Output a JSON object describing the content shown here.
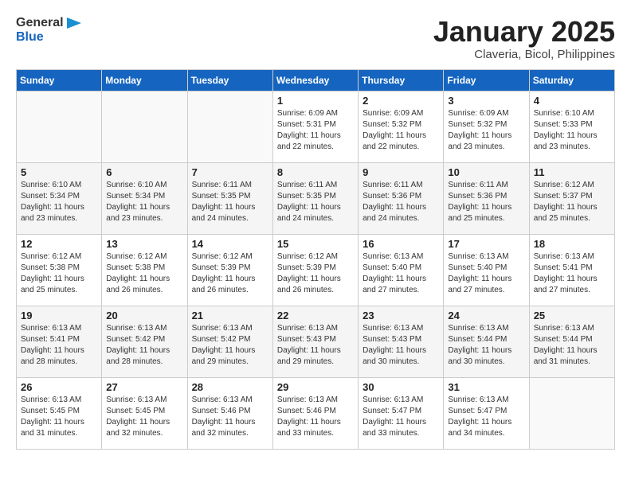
{
  "logo": {
    "line1": "General",
    "line2": "Blue"
  },
  "title": "January 2025",
  "subtitle": "Claveria, Bicol, Philippines",
  "headers": [
    "Sunday",
    "Monday",
    "Tuesday",
    "Wednesday",
    "Thursday",
    "Friday",
    "Saturday"
  ],
  "weeks": [
    [
      {
        "day": "",
        "info": ""
      },
      {
        "day": "",
        "info": ""
      },
      {
        "day": "",
        "info": ""
      },
      {
        "day": "1",
        "info": "Sunrise: 6:09 AM\nSunset: 5:31 PM\nDaylight: 11 hours and 22 minutes."
      },
      {
        "day": "2",
        "info": "Sunrise: 6:09 AM\nSunset: 5:32 PM\nDaylight: 11 hours and 22 minutes."
      },
      {
        "day": "3",
        "info": "Sunrise: 6:09 AM\nSunset: 5:32 PM\nDaylight: 11 hours and 23 minutes."
      },
      {
        "day": "4",
        "info": "Sunrise: 6:10 AM\nSunset: 5:33 PM\nDaylight: 11 hours and 23 minutes."
      }
    ],
    [
      {
        "day": "5",
        "info": "Sunrise: 6:10 AM\nSunset: 5:34 PM\nDaylight: 11 hours and 23 minutes."
      },
      {
        "day": "6",
        "info": "Sunrise: 6:10 AM\nSunset: 5:34 PM\nDaylight: 11 hours and 23 minutes."
      },
      {
        "day": "7",
        "info": "Sunrise: 6:11 AM\nSunset: 5:35 PM\nDaylight: 11 hours and 24 minutes."
      },
      {
        "day": "8",
        "info": "Sunrise: 6:11 AM\nSunset: 5:35 PM\nDaylight: 11 hours and 24 minutes."
      },
      {
        "day": "9",
        "info": "Sunrise: 6:11 AM\nSunset: 5:36 PM\nDaylight: 11 hours and 24 minutes."
      },
      {
        "day": "10",
        "info": "Sunrise: 6:11 AM\nSunset: 5:36 PM\nDaylight: 11 hours and 25 minutes."
      },
      {
        "day": "11",
        "info": "Sunrise: 6:12 AM\nSunset: 5:37 PM\nDaylight: 11 hours and 25 minutes."
      }
    ],
    [
      {
        "day": "12",
        "info": "Sunrise: 6:12 AM\nSunset: 5:38 PM\nDaylight: 11 hours and 25 minutes."
      },
      {
        "day": "13",
        "info": "Sunrise: 6:12 AM\nSunset: 5:38 PM\nDaylight: 11 hours and 26 minutes."
      },
      {
        "day": "14",
        "info": "Sunrise: 6:12 AM\nSunset: 5:39 PM\nDaylight: 11 hours and 26 minutes."
      },
      {
        "day": "15",
        "info": "Sunrise: 6:12 AM\nSunset: 5:39 PM\nDaylight: 11 hours and 26 minutes."
      },
      {
        "day": "16",
        "info": "Sunrise: 6:13 AM\nSunset: 5:40 PM\nDaylight: 11 hours and 27 minutes."
      },
      {
        "day": "17",
        "info": "Sunrise: 6:13 AM\nSunset: 5:40 PM\nDaylight: 11 hours and 27 minutes."
      },
      {
        "day": "18",
        "info": "Sunrise: 6:13 AM\nSunset: 5:41 PM\nDaylight: 11 hours and 27 minutes."
      }
    ],
    [
      {
        "day": "19",
        "info": "Sunrise: 6:13 AM\nSunset: 5:41 PM\nDaylight: 11 hours and 28 minutes."
      },
      {
        "day": "20",
        "info": "Sunrise: 6:13 AM\nSunset: 5:42 PM\nDaylight: 11 hours and 28 minutes."
      },
      {
        "day": "21",
        "info": "Sunrise: 6:13 AM\nSunset: 5:42 PM\nDaylight: 11 hours and 29 minutes."
      },
      {
        "day": "22",
        "info": "Sunrise: 6:13 AM\nSunset: 5:43 PM\nDaylight: 11 hours and 29 minutes."
      },
      {
        "day": "23",
        "info": "Sunrise: 6:13 AM\nSunset: 5:43 PM\nDaylight: 11 hours and 30 minutes."
      },
      {
        "day": "24",
        "info": "Sunrise: 6:13 AM\nSunset: 5:44 PM\nDaylight: 11 hours and 30 minutes."
      },
      {
        "day": "25",
        "info": "Sunrise: 6:13 AM\nSunset: 5:44 PM\nDaylight: 11 hours and 31 minutes."
      }
    ],
    [
      {
        "day": "26",
        "info": "Sunrise: 6:13 AM\nSunset: 5:45 PM\nDaylight: 11 hours and 31 minutes."
      },
      {
        "day": "27",
        "info": "Sunrise: 6:13 AM\nSunset: 5:45 PM\nDaylight: 11 hours and 32 minutes."
      },
      {
        "day": "28",
        "info": "Sunrise: 6:13 AM\nSunset: 5:46 PM\nDaylight: 11 hours and 32 minutes."
      },
      {
        "day": "29",
        "info": "Sunrise: 6:13 AM\nSunset: 5:46 PM\nDaylight: 11 hours and 33 minutes."
      },
      {
        "day": "30",
        "info": "Sunrise: 6:13 AM\nSunset: 5:47 PM\nDaylight: 11 hours and 33 minutes."
      },
      {
        "day": "31",
        "info": "Sunrise: 6:13 AM\nSunset: 5:47 PM\nDaylight: 11 hours and 34 minutes."
      },
      {
        "day": "",
        "info": ""
      }
    ]
  ]
}
